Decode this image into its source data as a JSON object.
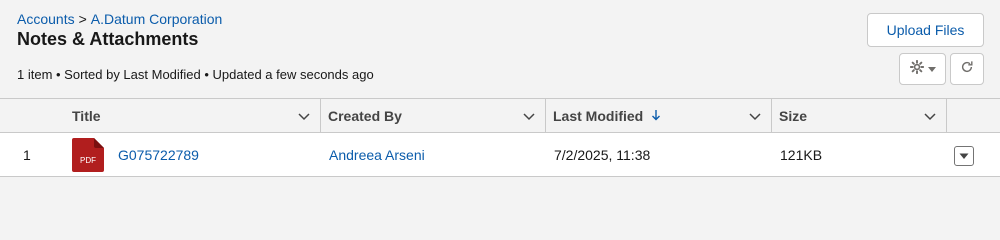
{
  "breadcrumb": {
    "parent": "Accounts",
    "separator": ">",
    "current": "A.Datum Corporation"
  },
  "page_title": "Notes & Attachments",
  "meta": "1 item • Sorted by Last Modified • Updated a few seconds ago",
  "actions": {
    "upload_label": "Upload Files"
  },
  "icons": {
    "gear": "gear-icon",
    "caret": "caret-down-icon",
    "refresh": "refresh-icon",
    "chevron": "chevron-down-icon",
    "sort": "arrow-down-icon",
    "pdf": "pdf-file-icon"
  },
  "columns": [
    {
      "label": "Title"
    },
    {
      "label": "Created By"
    },
    {
      "label": "Last Modified"
    },
    {
      "label": "Size"
    }
  ],
  "rows": [
    {
      "index": "1",
      "file_type": "PDF",
      "title": "G075722789",
      "created_by": "Andreea Arseni",
      "last_modified": "7/2/2025, 11:38",
      "size": "121KB"
    }
  ],
  "colors": {
    "link": "#0b5cab",
    "pdf_red": "#b11e1e",
    "background": "#f3f3f3",
    "border": "#c9c9c9"
  }
}
